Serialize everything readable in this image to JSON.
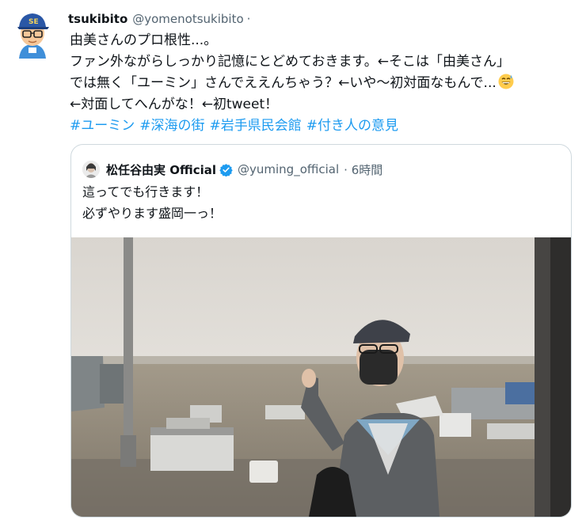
{
  "tweet": {
    "display_name": "tsukibito",
    "handle": "@yomenotsukibito",
    "separator": "·",
    "lines": [
      "由美さんのプロ根性...。",
      "ファン外ながらしっかり記憶にとどめておきます。←そこは「由美さん」",
      "では無く「ユーミン」さんでええんちゃう？←いや～初対面なもんで...",
      "←対面してへんがな！←初tweet！"
    ],
    "emoji": "grinning-sweat-emoji",
    "hashtags": [
      "#ユーミン",
      "#深海の街",
      "#岩手県民会館",
      "#付き人の意見"
    ]
  },
  "quoted": {
    "display_name": "松任谷由実 Official",
    "verified_icon": "verified-badge-icon",
    "handle": "@yuming_official",
    "time": "· 6時間",
    "lines": [
      "這ってでも行きます！",
      "必ずやります盛岡一っ！"
    ],
    "photo": "airport-window-photo"
  },
  "colors": {
    "link": "#1d9bf0",
    "secondary": "#536471",
    "border": "#cfd9de"
  }
}
